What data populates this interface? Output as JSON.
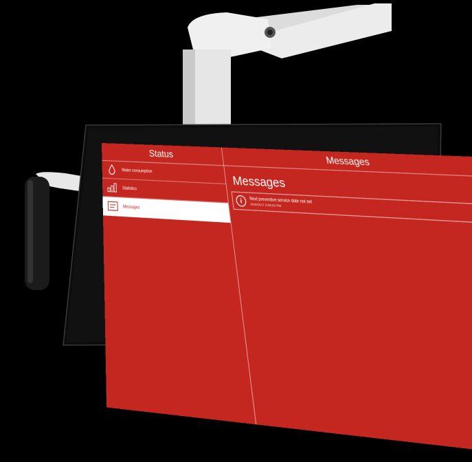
{
  "status": {
    "title": "Status"
  },
  "sidebar": {
    "items": [
      {
        "label": "Water consumption",
        "icon": "water-drop-icon"
      },
      {
        "label": "Statistics",
        "icon": "bar-chart-icon"
      },
      {
        "label": "Messages",
        "icon": "message-icon",
        "active": true
      }
    ]
  },
  "messages": {
    "header": "Messages",
    "title": "Messages",
    "list": [
      {
        "text": "Next preventive service date not set",
        "timestamp": "4/19/2017 3:05:00 PM",
        "icon": "info-icon"
      }
    ]
  },
  "colors": {
    "accent": "#c4271f",
    "background": "#000000",
    "arm": "#ececec"
  }
}
